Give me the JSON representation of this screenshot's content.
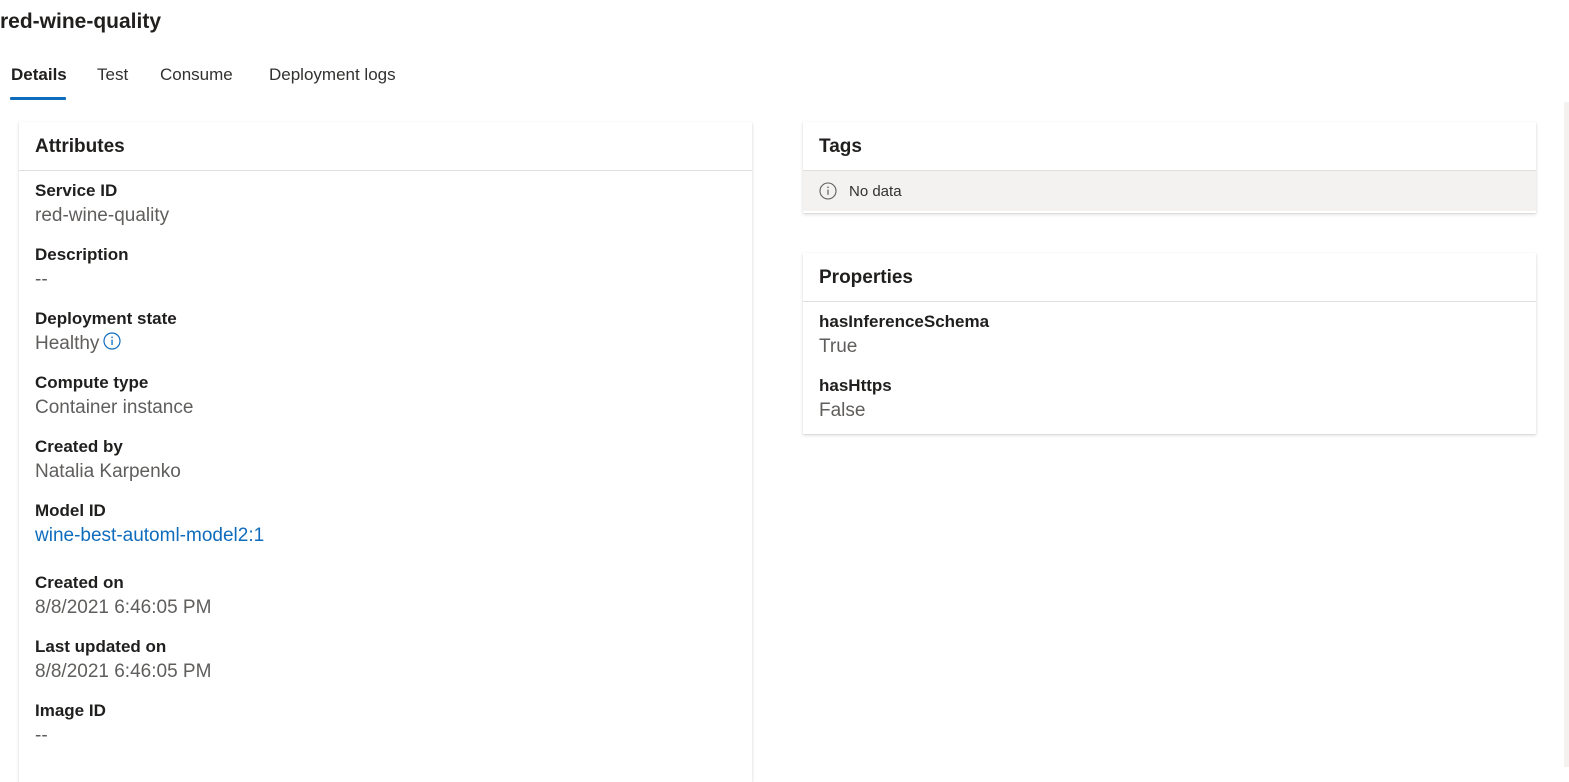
{
  "page": {
    "title": "red-wine-quality"
  },
  "tabs": [
    {
      "label": "Details",
      "active": true
    },
    {
      "label": "Test",
      "active": false
    },
    {
      "label": "Consume",
      "active": false
    },
    {
      "label": "Deployment logs",
      "active": false
    }
  ],
  "attributes": {
    "header": "Attributes",
    "items": [
      {
        "label": "Service ID",
        "value": "red-wine-quality"
      },
      {
        "label": "Description",
        "value": "--"
      },
      {
        "label": "Deployment state",
        "value": "Healthy",
        "icon": "info-icon"
      },
      {
        "label": "Compute type",
        "value": "Container instance"
      },
      {
        "label": "Created by",
        "value": "Natalia Karpenko"
      },
      {
        "label": "Model ID",
        "value": "wine-best-automl-model2:1",
        "link": true
      },
      {
        "label": "Created on",
        "value": "8/8/2021 6:46:05 PM"
      },
      {
        "label": "Last updated on",
        "value": "8/8/2021 6:46:05 PM"
      },
      {
        "label": "Image ID",
        "value": "--"
      }
    ]
  },
  "tags": {
    "header": "Tags",
    "empty_text": "No data",
    "icon": "info-icon"
  },
  "properties": {
    "header": "Properties",
    "items": [
      {
        "label": "hasInferenceSchema",
        "value": "True"
      },
      {
        "label": "hasHttps",
        "value": "False"
      }
    ]
  },
  "colors": {
    "accent": "#0f6cbd",
    "text_primary": "#201f1e",
    "text_secondary": "#605e5c",
    "empty_bg": "#f3f2f1"
  }
}
